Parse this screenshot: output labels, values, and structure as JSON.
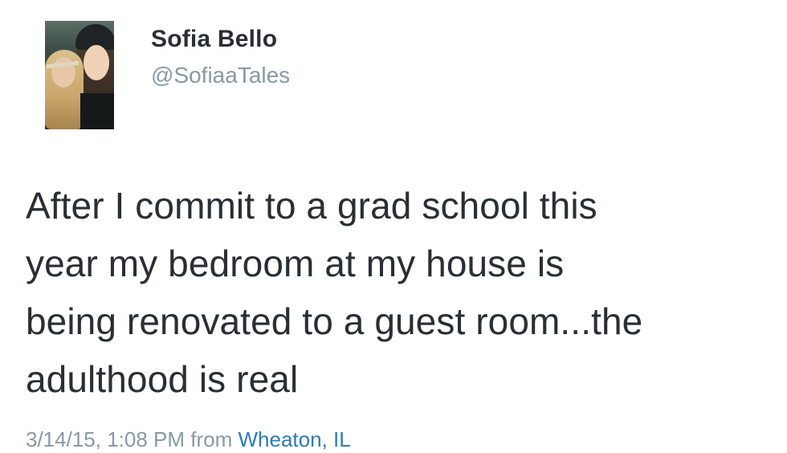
{
  "user": {
    "display_name": "Sofia Bello",
    "username": "@SofiaaTales"
  },
  "tweet": {
    "lines": [
      "After I commit to a grad school this",
      "year my bedroom at my house is",
      "being renovated to a guest room...the",
      "adulthood is real"
    ]
  },
  "meta": {
    "timestamp": "3/14/15, 1:08 PM",
    "from_label": "from",
    "location": "Wheaton, IL"
  },
  "colors": {
    "text": "#292f33",
    "secondary": "#8899a6",
    "link": "#2b7bb9"
  }
}
